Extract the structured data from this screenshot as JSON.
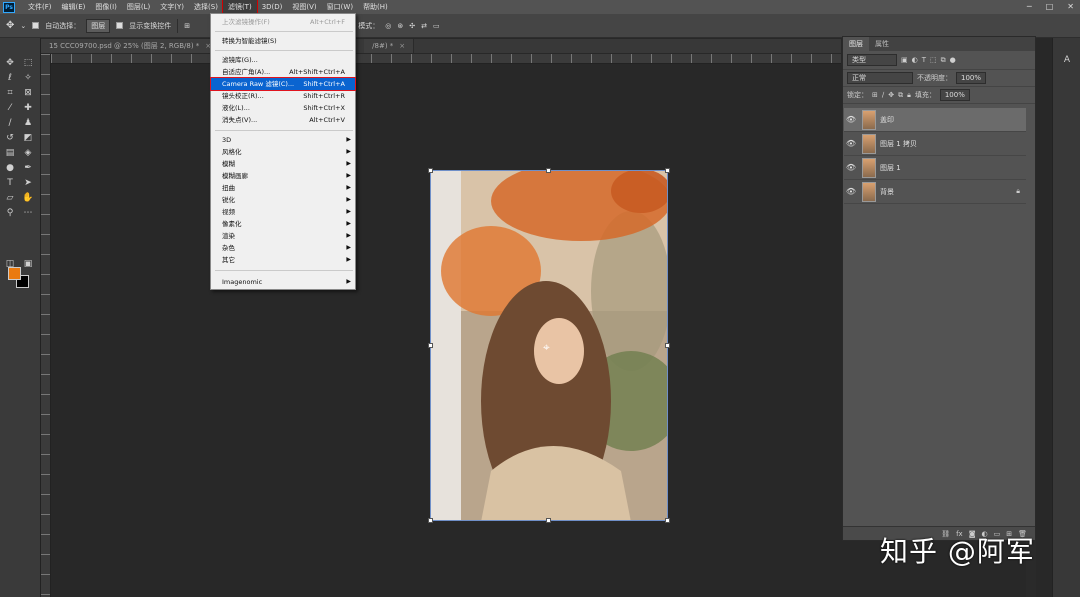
{
  "menubar": {
    "logo": "Ps",
    "items": [
      "文件(F)",
      "编辑(E)",
      "图像(I)",
      "图层(L)",
      "文字(Y)",
      "选择(S)",
      "滤镜(T)",
      "3D(D)",
      "视图(V)",
      "窗口(W)",
      "帮助(H)"
    ],
    "active_index": 6
  },
  "options": {
    "auto_select_label": "自动选择：",
    "auto_select_value": "图层",
    "show_transform_label": "显示变换控件",
    "mode_3d_label": "3D 模式："
  },
  "tabs": [
    {
      "label": "15 CCC09700.psd @ 25% (图层 2, RGB/8) *"
    },
    {
      "label": "/8#) *"
    }
  ],
  "filter_menu": {
    "last_filter": {
      "label": "上次滤镜操作(F)",
      "shortcut": "Alt+Ctrl+F"
    },
    "convert_smart": {
      "label": "转换为智能滤镜(S)"
    },
    "gallery": {
      "label": "滤镜库(G)..."
    },
    "adaptive_wide": {
      "label": "自适应广角(A)...",
      "shortcut": "Alt+Shift+Ctrl+A"
    },
    "camera_raw": {
      "label": "Camera Raw 滤镜(C)...",
      "shortcut": "Shift+Ctrl+A"
    },
    "lens_correction": {
      "label": "镜头校正(R)...",
      "shortcut": "Shift+Ctrl+R"
    },
    "liquify": {
      "label": "液化(L)...",
      "shortcut": "Shift+Ctrl+X"
    },
    "vanishing_point": {
      "label": "消失点(V)...",
      "shortcut": "Alt+Ctrl+V"
    },
    "submenus": [
      "3D",
      "风格化",
      "模糊",
      "模糊画廊",
      "扭曲",
      "锐化",
      "视频",
      "像素化",
      "渲染",
      "杂色",
      "其它"
    ],
    "imagenomic": {
      "label": "Imagenomic"
    }
  },
  "layers_panel": {
    "tabs": [
      "图层",
      "属性"
    ],
    "filter_kind": "类型",
    "blend_mode": "正常",
    "opacity_label": "不透明度：",
    "opacity_value": "100%",
    "lock_label": "锁定：",
    "fill_label": "填充：",
    "fill_value": "100%",
    "layers": [
      {
        "name": "盖印",
        "selected": true
      },
      {
        "name": "图层 1 拷贝",
        "selected": false
      },
      {
        "name": "图层 1",
        "selected": false
      },
      {
        "name": "背景",
        "selected": false,
        "locked": true
      }
    ]
  },
  "watermark": "知乎 @阿军",
  "colors": {
    "foreground": "#ea7a0f",
    "background": "#000000",
    "menu_highlight": "#0a64d0",
    "annotation_red": "#e0141e"
  }
}
